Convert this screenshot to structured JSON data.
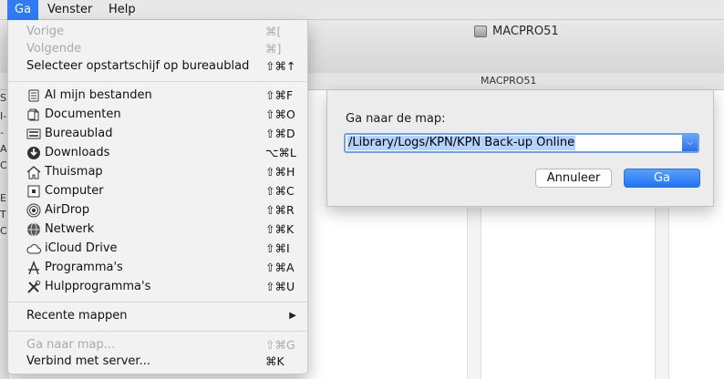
{
  "menubar": {
    "items": [
      {
        "label": "Ga",
        "active": true
      },
      {
        "label": "Venster",
        "active": false
      },
      {
        "label": "Help",
        "active": false
      }
    ]
  },
  "finder": {
    "window_title": "MACPRO51",
    "path_title": "MACPRO51",
    "sidebar_fragments": [
      "S",
      "I-",
      "-",
      "A",
      "C",
      "E",
      "T",
      "C"
    ]
  },
  "dialog": {
    "prompt": "Ga naar de map:",
    "path_value": "/Library/Logs/KPN/KPN Back-up Online",
    "cancel_label": "Annuleer",
    "go_label": "Ga"
  },
  "menu": {
    "nav": [
      {
        "label": "Vorige",
        "shortcut": "⌘[",
        "disabled": true
      },
      {
        "label": "Volgende",
        "shortcut": "⌘]",
        "disabled": true
      },
      {
        "label": "Selecteer opstartschijf op bureaublad",
        "shortcut": "⇧⌘↑",
        "disabled": false
      }
    ],
    "places": [
      {
        "label": "Al mijn bestanden",
        "shortcut": "⇧⌘F",
        "icon": "all-files-icon"
      },
      {
        "label": "Documenten",
        "shortcut": "⇧⌘O",
        "icon": "documents-icon"
      },
      {
        "label": "Bureaublad",
        "shortcut": "⇧⌘D",
        "icon": "desktop-icon"
      },
      {
        "label": "Downloads",
        "shortcut": "⌥⌘L",
        "icon": "downloads-icon"
      },
      {
        "label": "Thuismap",
        "shortcut": "⇧⌘H",
        "icon": "home-icon"
      },
      {
        "label": "Computer",
        "shortcut": "⇧⌘C",
        "icon": "computer-icon"
      },
      {
        "label": "AirDrop",
        "shortcut": "⇧⌘R",
        "icon": "airdrop-icon"
      },
      {
        "label": "Netwerk",
        "shortcut": "⇧⌘K",
        "icon": "network-icon"
      },
      {
        "label": "iCloud Drive",
        "shortcut": "⇧⌘I",
        "icon": "icloud-icon"
      },
      {
        "label": "Programma's",
        "shortcut": "⇧⌘A",
        "icon": "applications-icon"
      },
      {
        "label": "Hulpprogramma's",
        "shortcut": "⇧⌘U",
        "icon": "utilities-icon"
      }
    ],
    "recent": {
      "label": "Recente mappen"
    },
    "bottom": [
      {
        "label": "Ga naar map...",
        "shortcut": "⇧⌘G",
        "disabled": true
      },
      {
        "label": "Verbind met server...",
        "shortcut": "⌘K",
        "disabled": false
      }
    ]
  },
  "colors": {
    "accent": "#2f7bf5",
    "selection": "#b3d3fd",
    "disabled_text": "#a9a9a9"
  }
}
